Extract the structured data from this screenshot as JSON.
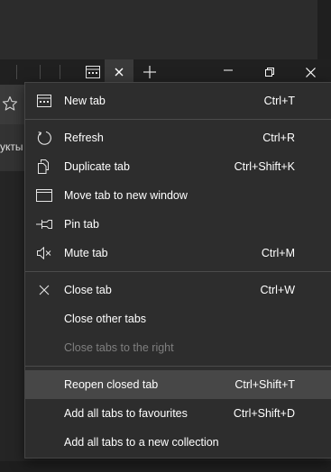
{
  "background": {
    "bookmark_text": "укты"
  },
  "menu": {
    "items": [
      {
        "label": "New tab",
        "shortcut": "Ctrl+T",
        "icon": "new-tab-icon"
      },
      {
        "label": "Refresh",
        "shortcut": "Ctrl+R",
        "icon": "refresh-icon"
      },
      {
        "label": "Duplicate tab",
        "shortcut": "Ctrl+Shift+K",
        "icon": "duplicate-tab-icon"
      },
      {
        "label": "Move tab to new window",
        "shortcut": "",
        "icon": "window-icon"
      },
      {
        "label": "Pin tab",
        "shortcut": "",
        "icon": "pin-icon"
      },
      {
        "label": "Mute tab",
        "shortcut": "Ctrl+M",
        "icon": "mute-icon"
      },
      {
        "label": "Close tab",
        "shortcut": "Ctrl+W",
        "icon": "close-icon"
      },
      {
        "label": "Close other tabs",
        "shortcut": ""
      },
      {
        "label": "Close tabs to the right",
        "shortcut": "",
        "disabled": true
      },
      {
        "label": "Reopen closed tab",
        "shortcut": "Ctrl+Shift+T",
        "highlighted": true
      },
      {
        "label": "Add all tabs to favourites",
        "shortcut": "Ctrl+Shift+D"
      },
      {
        "label": "Add all tabs to a new collection",
        "shortcut": ""
      }
    ]
  },
  "colors": {
    "menu_bg": "#2d2d2d",
    "highlight": "#474747",
    "text": "#ffffff",
    "disabled_text": "#7f7f7f"
  }
}
